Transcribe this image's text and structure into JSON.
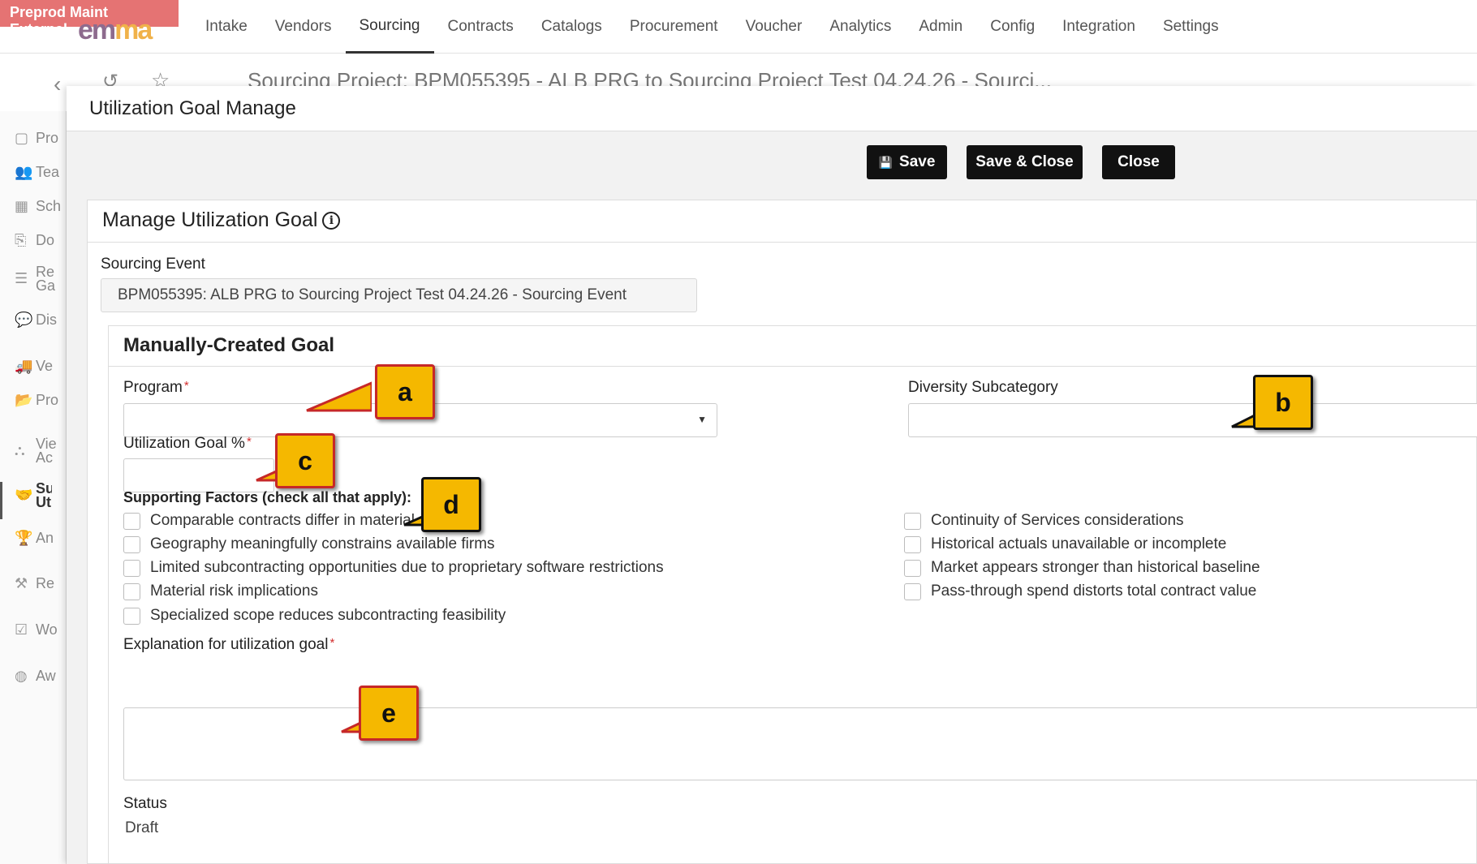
{
  "env_badge": "Preprod Maint External",
  "logo": {
    "part1": "em",
    "part2": "ma"
  },
  "nav": [
    "Intake",
    "Vendors",
    "Sourcing",
    "Contracts",
    "Catalogs",
    "Procurement",
    "Voucher",
    "Analytics",
    "Admin",
    "Config",
    "Integration",
    "Settings"
  ],
  "background_title": "Sourcing Project: BPM055395 - ALB PRG to Sourcing Project Test 04.24.26 - Sourci...",
  "left_nav": [
    {
      "icon": "clipboard-icon",
      "label": "Pro"
    },
    {
      "icon": "team-icon",
      "label": "Tea"
    },
    {
      "icon": "calendar-icon",
      "label": "Sch"
    },
    {
      "icon": "document-icon",
      "label": "Do"
    },
    {
      "icon": "list-icon",
      "label": "Re Ga"
    },
    {
      "icon": "chat-icon",
      "label": "Dis"
    },
    {
      "icon": "truck-icon",
      "label": "Ve"
    },
    {
      "icon": "folder-icon",
      "label": "Pro"
    },
    {
      "icon": "binoculars-icon",
      "label": "Vie Ac"
    },
    {
      "icon": "handshake-icon",
      "label": "Sub Uti"
    },
    {
      "icon": "trophy-icon",
      "label": "An"
    },
    {
      "icon": "gavel-icon",
      "label": "Re"
    },
    {
      "icon": "checkbox-icon",
      "label": "Wo"
    },
    {
      "icon": "award-icon",
      "label": "Aw"
    }
  ],
  "modal": {
    "title": "Utilization Goal Manage",
    "buttons": {
      "save": "Save",
      "save_close": "Save & Close",
      "close": "Close"
    },
    "panel_title": "Manage Utilization Goal",
    "sourcing_event_label": "Sourcing Event",
    "sourcing_event_value": "BPM055395: ALB PRG to Sourcing Project Test 04.24.26 - Sourcing Event",
    "goal_title": "Manually-Created Goal",
    "program_label": "Program",
    "program_value": "",
    "diversity_label": "Diversity Subcategory",
    "diversity_value": "",
    "util_goal_label": "Utilization Goal %",
    "util_goal_value": "",
    "supporting_label": "Supporting Factors (check all that apply):",
    "factors_left": [
      "Comparable contracts differ in material scope",
      "Geography meaningfully constrains available firms",
      "Limited subcontracting opportunities due to proprietary software restrictions",
      "Material risk implications",
      "Specialized scope reduces subcontracting feasibility"
    ],
    "factors_right": [
      "Continuity of Services considerations",
      "Historical actuals unavailable or incomplete",
      "Market appears stronger than historical baseline",
      "Pass-through spend distorts total contract value"
    ],
    "explanation_label": "Explanation for utilization goal",
    "explanation_value": "",
    "status_label": "Status",
    "status_value": "Draft"
  },
  "callouts": [
    "a",
    "b",
    "c",
    "d",
    "e"
  ]
}
